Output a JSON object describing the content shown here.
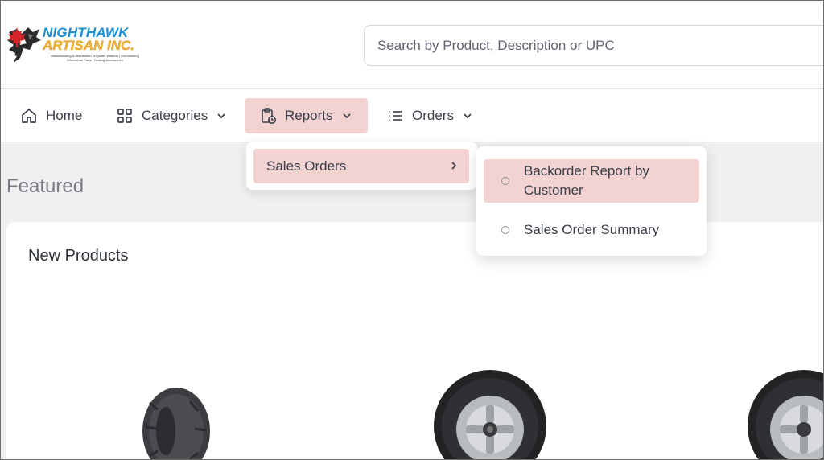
{
  "brand": {
    "line1": "NIGHTHAWK",
    "line2": "ARTISAN INC.",
    "tagline": "Manufacturing & Distribution of Quality Walkers | Commodes | Wheelchair Parts | Seating Accessories"
  },
  "search": {
    "placeholder": "Search by Product, Description or UPC"
  },
  "nav": {
    "home": "Home",
    "categories": "Categories",
    "reports": "Reports",
    "orders": "Orders"
  },
  "reports_menu": {
    "sales_orders": "Sales Orders",
    "submenu": {
      "backorder": "Backorder Report by Customer",
      "summary": "Sales Order Summary"
    }
  },
  "content": {
    "featured": "Featured",
    "new_products": "New Products"
  },
  "colors": {
    "active_bg": "#f3d2d2",
    "brand_blue": "#1b8fd6",
    "brand_gold": "#f2b233",
    "maple_red": "#d7262b"
  }
}
